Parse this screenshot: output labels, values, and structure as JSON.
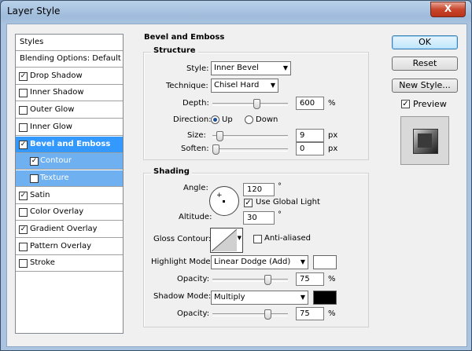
{
  "window": {
    "title": "Layer Style",
    "close_label": "X"
  },
  "styles_list": {
    "header": "Styles",
    "items": [
      {
        "label": "Blending Options: Default",
        "checkbox": false,
        "checked": false
      },
      {
        "label": "Drop Shadow",
        "checkbox": true,
        "checked": true
      },
      {
        "label": "Inner Shadow",
        "checkbox": true,
        "checked": false
      },
      {
        "label": "Outer Glow",
        "checkbox": true,
        "checked": false
      },
      {
        "label": "Inner Glow",
        "checkbox": true,
        "checked": false
      },
      {
        "label": "Bevel and Emboss",
        "checkbox": true,
        "checked": true,
        "selected": true
      },
      {
        "label": "Contour",
        "checkbox": true,
        "checked": true,
        "sub": true
      },
      {
        "label": "Texture",
        "checkbox": true,
        "checked": false,
        "sub": true
      },
      {
        "label": "Satin",
        "checkbox": true,
        "checked": true
      },
      {
        "label": "Color Overlay",
        "checkbox": true,
        "checked": false
      },
      {
        "label": "Gradient Overlay",
        "checkbox": true,
        "checked": true
      },
      {
        "label": "Pattern Overlay",
        "checkbox": true,
        "checked": false
      },
      {
        "label": "Stroke",
        "checkbox": true,
        "checked": false
      }
    ]
  },
  "bevel": {
    "section_title": "Bevel and Emboss",
    "structure": {
      "title": "Structure",
      "style_label": "Style:",
      "style_value": "Inner Bevel",
      "technique_label": "Technique:",
      "technique_value": "Chisel Hard",
      "depth_label": "Depth:",
      "depth_value": "600",
      "depth_unit": "%",
      "depth_slider": 0.59,
      "direction_label": "Direction:",
      "direction_up": "Up",
      "direction_down": "Down",
      "direction_selected": "Up",
      "size_label": "Size:",
      "size_value": "9",
      "size_unit": "px",
      "size_slider": 0.06,
      "soften_label": "Soften:",
      "soften_value": "0",
      "soften_unit": "px",
      "soften_slider": 0.0
    },
    "shading": {
      "title": "Shading",
      "angle_label": "Angle:",
      "angle_value": "120",
      "angle_unit": "°",
      "global_light_label": "Use Global Light",
      "global_light_checked": true,
      "altitude_label": "Altitude:",
      "altitude_value": "30",
      "altitude_unit": "°",
      "gloss_label": "Gloss Contour:",
      "anti_aliased_label": "Anti-aliased",
      "anti_aliased_checked": false,
      "highlight_mode_label": "Highlight Mode:",
      "highlight_mode_value": "Linear Dodge (Add)",
      "highlight_color": "#ffffff",
      "highlight_opacity_label": "Opacity:",
      "highlight_opacity_value": "75",
      "highlight_opacity_unit": "%",
      "highlight_opacity_slider": 0.75,
      "shadow_mode_label": "Shadow Mode:",
      "shadow_mode_value": "Multiply",
      "shadow_color": "#000000",
      "shadow_opacity_label": "Opacity:",
      "shadow_opacity_value": "75",
      "shadow_opacity_unit": "%",
      "shadow_opacity_slider": 0.75
    }
  },
  "buttons": {
    "ok": "OK",
    "reset": "Reset",
    "new_style": "New Style...",
    "preview_label": "Preview",
    "preview_checked": true
  },
  "colors": {
    "selected": "#3399ff",
    "sub_selected": "#6fb0f0"
  }
}
